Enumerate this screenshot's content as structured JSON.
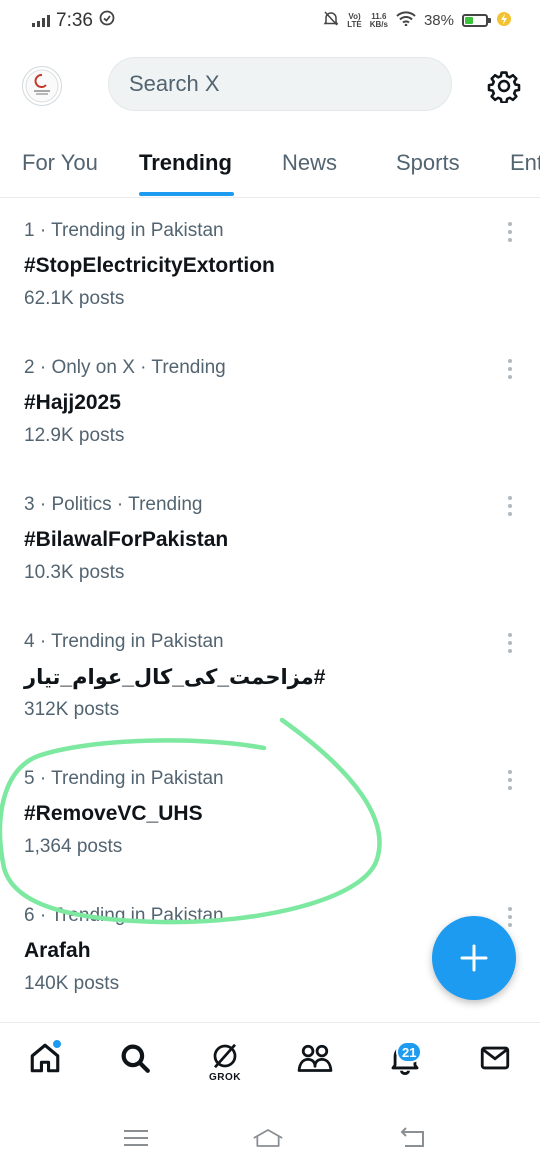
{
  "status_bar": {
    "time": "7:36",
    "volte_top": "Vo)",
    "volte_bottom": "LTE",
    "speed_top": "11.6",
    "speed_bottom": "KB/s",
    "battery": "38%",
    "battery_level": 0.38
  },
  "search": {
    "placeholder": "Search X"
  },
  "tabs": [
    "For You",
    "Trending",
    "News",
    "Sports",
    "Ent"
  ],
  "active_tab": "Trending",
  "trends": [
    {
      "meta": "1 · Trending in Pakistan",
      "name": "#StopElectricityExtortion",
      "posts": "62.1K posts"
    },
    {
      "meta": "2 · Only on X · Trending",
      "name": "#Hajj2025",
      "posts": "12.9K posts"
    },
    {
      "meta": "3 · Politics · Trending",
      "name": "#BilawalForPakistan",
      "posts": "10.3K posts"
    },
    {
      "meta": "4 · Trending in Pakistan",
      "name": "#مزاحمت_کی_کال_عوام_تیار",
      "posts": "312K posts"
    },
    {
      "meta": "5 · Trending in Pakistan",
      "name": "#RemoveVC_UHS",
      "posts": "1,364 posts"
    },
    {
      "meta": "6 · Trending in Pakistan",
      "name": "Arafah",
      "posts": "140K posts"
    }
  ],
  "bottom_nav": {
    "grok_label": "GROK",
    "notifications_badge": "21"
  },
  "colors": {
    "accent": "#1d9bf0",
    "annotation": "#7de8a0",
    "text_primary": "#0f1419",
    "text_secondary": "#536471"
  },
  "icons": [
    "home-icon",
    "search-icon",
    "grok-icon",
    "communities-icon",
    "bell-icon",
    "mail-icon",
    "gear-icon",
    "plus-icon"
  ]
}
